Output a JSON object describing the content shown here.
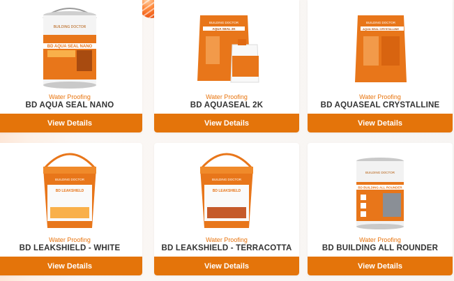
{
  "products": [
    {
      "category": "Water Proofing",
      "name": "BD AQUA SEAL NANO",
      "button": "View Details",
      "product_label": "BD AQUA SEAL NANO"
    },
    {
      "category": "Water Proofing",
      "name": "BD AQUASEAL 2K",
      "button": "View Details",
      "product_label": "AQUA SEAL 2K"
    },
    {
      "category": "Water Proofing",
      "name": "BD AQUASEAL CRYSTALLINE",
      "button": "View Details",
      "product_label": "AQUA SEAL CRYSTALLINE"
    },
    {
      "category": "Water Proofing",
      "name": "BD LEAKSHIELD - WHITE",
      "button": "View Details",
      "product_label": "BD LEAKSHIELD"
    },
    {
      "category": "Water Proofing",
      "name": "BD LEAKSHIELD - TERRACOTTA",
      "button": "View Details",
      "product_label": "BD LEAKSHIELD"
    },
    {
      "category": "Water Proofing",
      "name": "BD BUILDING ALL ROUNDER",
      "button": "View Details",
      "product_label": "BD BUILDING ALL ROUNDER"
    }
  ],
  "brand_logo_text": "BUILDING DOCTOR",
  "icons": {
    "decorative": "orange-striped-ball-icon",
    "product": "product-image-icon"
  },
  "colors": {
    "accent": "#e4740a",
    "category_text": "#e8730c",
    "title_text": "#333333",
    "card_bg": "#ffffff"
  }
}
